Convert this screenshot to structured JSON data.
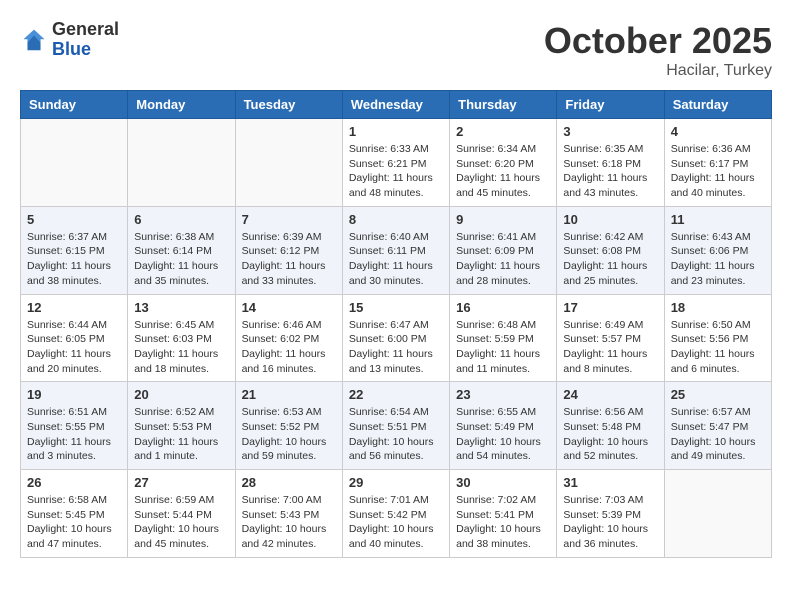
{
  "logo": {
    "general": "General",
    "blue": "Blue"
  },
  "title": "October 2025",
  "location": "Hacilar, Turkey",
  "days_of_week": [
    "Sunday",
    "Monday",
    "Tuesday",
    "Wednesday",
    "Thursday",
    "Friday",
    "Saturday"
  ],
  "weeks": [
    {
      "shaded": false,
      "days": [
        {
          "number": "",
          "info": ""
        },
        {
          "number": "",
          "info": ""
        },
        {
          "number": "",
          "info": ""
        },
        {
          "number": "1",
          "info": "Sunrise: 6:33 AM\nSunset: 6:21 PM\nDaylight: 11 hours\nand 48 minutes."
        },
        {
          "number": "2",
          "info": "Sunrise: 6:34 AM\nSunset: 6:20 PM\nDaylight: 11 hours\nand 45 minutes."
        },
        {
          "number": "3",
          "info": "Sunrise: 6:35 AM\nSunset: 6:18 PM\nDaylight: 11 hours\nand 43 minutes."
        },
        {
          "number": "4",
          "info": "Sunrise: 6:36 AM\nSunset: 6:17 PM\nDaylight: 11 hours\nand 40 minutes."
        }
      ]
    },
    {
      "shaded": true,
      "days": [
        {
          "number": "5",
          "info": "Sunrise: 6:37 AM\nSunset: 6:15 PM\nDaylight: 11 hours\nand 38 minutes."
        },
        {
          "number": "6",
          "info": "Sunrise: 6:38 AM\nSunset: 6:14 PM\nDaylight: 11 hours\nand 35 minutes."
        },
        {
          "number": "7",
          "info": "Sunrise: 6:39 AM\nSunset: 6:12 PM\nDaylight: 11 hours\nand 33 minutes."
        },
        {
          "number": "8",
          "info": "Sunrise: 6:40 AM\nSunset: 6:11 PM\nDaylight: 11 hours\nand 30 minutes."
        },
        {
          "number": "9",
          "info": "Sunrise: 6:41 AM\nSunset: 6:09 PM\nDaylight: 11 hours\nand 28 minutes."
        },
        {
          "number": "10",
          "info": "Sunrise: 6:42 AM\nSunset: 6:08 PM\nDaylight: 11 hours\nand 25 minutes."
        },
        {
          "number": "11",
          "info": "Sunrise: 6:43 AM\nSunset: 6:06 PM\nDaylight: 11 hours\nand 23 minutes."
        }
      ]
    },
    {
      "shaded": false,
      "days": [
        {
          "number": "12",
          "info": "Sunrise: 6:44 AM\nSunset: 6:05 PM\nDaylight: 11 hours\nand 20 minutes."
        },
        {
          "number": "13",
          "info": "Sunrise: 6:45 AM\nSunset: 6:03 PM\nDaylight: 11 hours\nand 18 minutes."
        },
        {
          "number": "14",
          "info": "Sunrise: 6:46 AM\nSunset: 6:02 PM\nDaylight: 11 hours\nand 16 minutes."
        },
        {
          "number": "15",
          "info": "Sunrise: 6:47 AM\nSunset: 6:00 PM\nDaylight: 11 hours\nand 13 minutes."
        },
        {
          "number": "16",
          "info": "Sunrise: 6:48 AM\nSunset: 5:59 PM\nDaylight: 11 hours\nand 11 minutes."
        },
        {
          "number": "17",
          "info": "Sunrise: 6:49 AM\nSunset: 5:57 PM\nDaylight: 11 hours\nand 8 minutes."
        },
        {
          "number": "18",
          "info": "Sunrise: 6:50 AM\nSunset: 5:56 PM\nDaylight: 11 hours\nand 6 minutes."
        }
      ]
    },
    {
      "shaded": true,
      "days": [
        {
          "number": "19",
          "info": "Sunrise: 6:51 AM\nSunset: 5:55 PM\nDaylight: 11 hours\nand 3 minutes."
        },
        {
          "number": "20",
          "info": "Sunrise: 6:52 AM\nSunset: 5:53 PM\nDaylight: 11 hours\nand 1 minute."
        },
        {
          "number": "21",
          "info": "Sunrise: 6:53 AM\nSunset: 5:52 PM\nDaylight: 10 hours\nand 59 minutes."
        },
        {
          "number": "22",
          "info": "Sunrise: 6:54 AM\nSunset: 5:51 PM\nDaylight: 10 hours\nand 56 minutes."
        },
        {
          "number": "23",
          "info": "Sunrise: 6:55 AM\nSunset: 5:49 PM\nDaylight: 10 hours\nand 54 minutes."
        },
        {
          "number": "24",
          "info": "Sunrise: 6:56 AM\nSunset: 5:48 PM\nDaylight: 10 hours\nand 52 minutes."
        },
        {
          "number": "25",
          "info": "Sunrise: 6:57 AM\nSunset: 5:47 PM\nDaylight: 10 hours\nand 49 minutes."
        }
      ]
    },
    {
      "shaded": false,
      "days": [
        {
          "number": "26",
          "info": "Sunrise: 6:58 AM\nSunset: 5:45 PM\nDaylight: 10 hours\nand 47 minutes."
        },
        {
          "number": "27",
          "info": "Sunrise: 6:59 AM\nSunset: 5:44 PM\nDaylight: 10 hours\nand 45 minutes."
        },
        {
          "number": "28",
          "info": "Sunrise: 7:00 AM\nSunset: 5:43 PM\nDaylight: 10 hours\nand 42 minutes."
        },
        {
          "number": "29",
          "info": "Sunrise: 7:01 AM\nSunset: 5:42 PM\nDaylight: 10 hours\nand 40 minutes."
        },
        {
          "number": "30",
          "info": "Sunrise: 7:02 AM\nSunset: 5:41 PM\nDaylight: 10 hours\nand 38 minutes."
        },
        {
          "number": "31",
          "info": "Sunrise: 7:03 AM\nSunset: 5:39 PM\nDaylight: 10 hours\nand 36 minutes."
        },
        {
          "number": "",
          "info": ""
        }
      ]
    }
  ]
}
